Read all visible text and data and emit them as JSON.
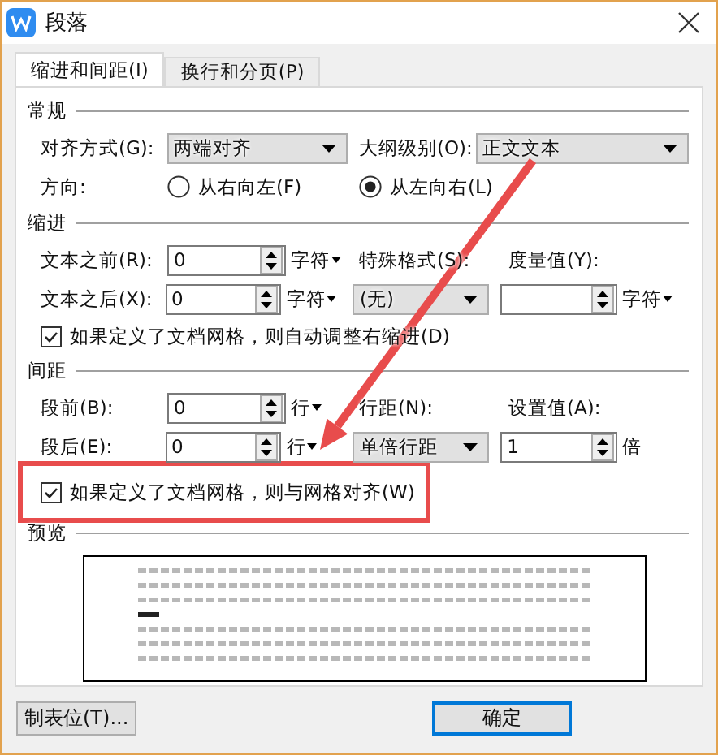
{
  "window": {
    "title": "段落"
  },
  "tabs": [
    {
      "label": "缩进和间距(I)",
      "selected": true
    },
    {
      "label": "换行和分页(P)",
      "selected": false
    }
  ],
  "general": {
    "heading": "常规",
    "alignment": {
      "label": "对齐方式(G):",
      "value": "两端对齐"
    },
    "outline_level": {
      "label": "大纲级别(O):",
      "value": "正文文本"
    },
    "direction": {
      "label": "方向:",
      "options": [
        {
          "label": "从右向左(F)",
          "selected": false
        },
        {
          "label": "从左向右(L)",
          "selected": true
        }
      ]
    }
  },
  "indent": {
    "heading": "缩进",
    "before": {
      "label": "文本之前(R):",
      "value": "0",
      "unit": "字符"
    },
    "after": {
      "label": "文本之后(X):",
      "value": "0",
      "unit": "字符"
    },
    "special": {
      "label": "特殊格式(S):",
      "value": "(无)"
    },
    "measure": {
      "label": "度量值(Y):",
      "unit": "字符"
    },
    "grid_option": {
      "label": "如果定义了文档网格，则自动调整右缩进(D)",
      "checked": true
    }
  },
  "spacing": {
    "heading": "间距",
    "before": {
      "label": "段前(B):",
      "value": "0",
      "unit": "行"
    },
    "after": {
      "label": "段后(E):",
      "value": "0",
      "unit": "行"
    },
    "line_spacing": {
      "label": "行距(N):",
      "value": "单倍行距"
    },
    "amount": {
      "label": "设置值(A):",
      "value": "1",
      "unit": "倍"
    },
    "grid_option": {
      "label": "如果定义了文档网格，则与网格对齐(W)",
      "checked": true
    }
  },
  "preview": {
    "heading": "预览"
  },
  "buttons": [
    {
      "label": "制表位(T)..."
    },
    {
      "label": "确定"
    }
  ]
}
